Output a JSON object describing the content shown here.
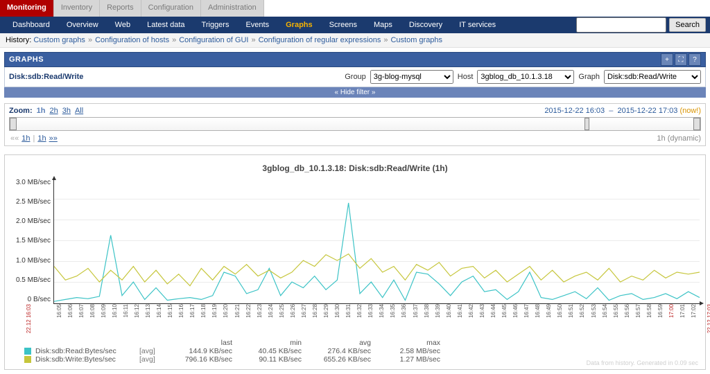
{
  "tabs": [
    "Monitoring",
    "Inventory",
    "Reports",
    "Configuration",
    "Administration"
  ],
  "tab_active": "Monitoring",
  "menu": [
    "Dashboard",
    "Overview",
    "Web",
    "Latest data",
    "Triggers",
    "Events",
    "Graphs",
    "Screens",
    "Maps",
    "Discovery",
    "IT services"
  ],
  "menu_active": "Graphs",
  "search": {
    "placeholder": "",
    "button": "Search"
  },
  "history": {
    "label": "History:",
    "items": [
      "Custom graphs",
      "Configuration of hosts",
      "Configuration of GUI",
      "Configuration of regular expressions",
      "Custom graphs"
    ]
  },
  "section_title": "GRAPHS",
  "selector": {
    "title": "Disk:sdb:Read/Write",
    "group_label": "Group",
    "group_value": "3g-blog-mysql",
    "host_label": "Host",
    "host_value": "3gblog_db_10.1.3.18",
    "graph_label": "Graph",
    "graph_value": "Disk:sdb:Read/Write"
  },
  "hide_filter": "« Hide filter »",
  "range": {
    "zoom_label": "Zoom:",
    "zoom_opts": [
      "1h",
      "2h",
      "3h",
      "All"
    ],
    "zoom_selected": "1h",
    "from": "2015-12-22 16:03",
    "to": "2015-12-22 17:03",
    "now": "(now!)",
    "pager_left": [
      "««",
      "1h",
      "|",
      "1h",
      "»»"
    ],
    "pager_right": "1h (dynamic)"
  },
  "chart_data": {
    "type": "line",
    "title": "3gblog_db_10.1.3.18: Disk:sdb:Read/Write (1h)",
    "ylabel": "",
    "ylim": [
      0,
      3.2
    ],
    "y_ticks": [
      "3.0 MB/sec",
      "2.5 MB/sec",
      "2.0 MB/sec",
      "1.5 MB/sec",
      "1.0 MB/sec",
      "0.5 MB/sec",
      "0 B/sec"
    ],
    "x_ticks": [
      "16:05",
      "16:06",
      "16:07",
      "16:08",
      "16:09",
      "16:10",
      "16:11",
      "16:12",
      "16:13",
      "16:14",
      "16:15",
      "16:16",
      "16:17",
      "16:18",
      "16:19",
      "16:20",
      "16:21",
      "16:22",
      "16:23",
      "16:24",
      "16:25",
      "16:26",
      "16:27",
      "16:28",
      "16:29",
      "16:30",
      "16:31",
      "16:32",
      "16:33",
      "16:34",
      "16:35",
      "16:36",
      "16:37",
      "16:38",
      "16:39",
      "16:40",
      "16:41",
      "16:42",
      "16:43",
      "16:44",
      "16:45",
      "16:46",
      "16:47",
      "16:48",
      "16:49",
      "16:50",
      "16:51",
      "16:52",
      "16:53",
      "16:54",
      "16:55",
      "16:56",
      "16:57",
      "16:58",
      "16:59",
      "17:00",
      "17:01",
      "17:02"
    ],
    "x_red_start": "22.12  16:03",
    "x_red_end": "22.12  17:03",
    "x_red_hour": "17:00",
    "series": [
      {
        "name": "Disk:sdb:Read:Bytes/sec",
        "agg": "[avg]",
        "color": "#3cc3c6",
        "values": [
          0.05,
          0.1,
          0.15,
          0.12,
          0.18,
          1.75,
          0.2,
          0.55,
          0.1,
          0.4,
          0.08,
          0.12,
          0.15,
          0.1,
          0.2,
          0.8,
          0.7,
          0.25,
          0.35,
          0.9,
          0.2,
          0.55,
          0.4,
          0.7,
          0.35,
          0.6,
          2.58,
          0.25,
          0.55,
          0.15,
          0.6,
          0.08,
          0.8,
          0.75,
          0.5,
          0.2,
          0.55,
          0.7,
          0.3,
          0.35,
          0.1,
          0.3,
          0.8,
          0.15,
          0.1,
          0.2,
          0.3,
          0.12,
          0.4,
          0.08,
          0.2,
          0.25,
          0.1,
          0.15,
          0.25,
          0.12,
          0.3,
          0.15
        ],
        "last": "144.9 KB/sec",
        "min": "40.45 KB/sec",
        "avg": "276.4 KB/sec",
        "max": "2.58 MB/sec"
      },
      {
        "name": "Disk:sdb:Write:Bytes/sec",
        "agg": "[avg]",
        "color": "#c6c63c",
        "values": [
          0.95,
          0.6,
          0.7,
          0.9,
          0.55,
          0.85,
          0.6,
          0.95,
          0.55,
          0.85,
          0.5,
          0.75,
          0.45,
          0.9,
          0.6,
          0.95,
          0.75,
          1.0,
          0.7,
          0.85,
          0.65,
          0.8,
          1.1,
          0.95,
          1.25,
          1.1,
          1.27,
          0.9,
          1.15,
          0.8,
          0.95,
          0.6,
          1.0,
          0.85,
          1.05,
          0.7,
          0.9,
          0.95,
          0.65,
          0.85,
          0.55,
          0.75,
          0.95,
          0.6,
          0.85,
          0.55,
          0.7,
          0.8,
          0.6,
          0.9,
          0.55,
          0.7,
          0.6,
          0.85,
          0.65,
          0.8,
          0.75,
          0.8
        ],
        "last": "796.16 KB/sec",
        "min": "90.11 KB/sec",
        "avg": "655.26 KB/sec",
        "max": "1.27 MB/sec"
      }
    ]
  },
  "legend_headers": [
    "last",
    "min",
    "avg",
    "max"
  ],
  "footer_note": "Data from history. Generated in 0.09 sec"
}
